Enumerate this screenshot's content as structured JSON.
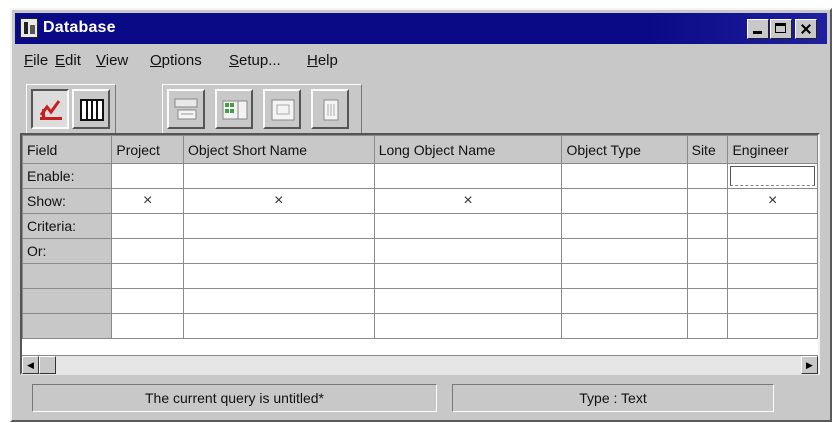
{
  "window": {
    "title": "Database",
    "controls": [
      "minimize-icon",
      "maximize-icon",
      "close-icon"
    ]
  },
  "menu": [
    {
      "label": "File",
      "accel": "F",
      "rest": "ile"
    },
    {
      "label": "Edit",
      "accel": "E",
      "rest": "dit"
    },
    {
      "label": "View",
      "accel": "V",
      "rest": "iew"
    },
    {
      "label": "Options",
      "accel": "O",
      "rest": "ptions"
    },
    {
      "label": "Setup...",
      "accel": "S",
      "rest": "etup..."
    },
    {
      "label": "Help",
      "accel": "H",
      "rest": "elp"
    }
  ],
  "toolbar": {
    "group1": [
      "query-chart-icon",
      "grid-view-icon"
    ],
    "group2": [
      "form-view-icon",
      "table-columns-icon",
      "report-icon",
      "trash-icon"
    ]
  },
  "grid": {
    "columns": [
      "Field",
      "Project",
      "Object Short Name",
      "Long Object Name",
      "Object Type",
      "Site",
      "Engineer"
    ],
    "rows": [
      {
        "label": "Enable:",
        "cells": [
          "",
          "",
          "",
          "",
          "",
          ""
        ]
      },
      {
        "label": "Show:",
        "cells": [
          "×",
          "×",
          "×",
          "",
          "",
          "×"
        ]
      },
      {
        "label": "Criteria:",
        "cells": [
          "",
          "",
          "",
          "",
          "",
          ""
        ]
      },
      {
        "label": "Or:",
        "cells": [
          "",
          "",
          "",
          "",
          "",
          ""
        ]
      },
      {
        "label": "",
        "cells": [
          "",
          "",
          "",
          "",
          "",
          ""
        ]
      },
      {
        "label": "",
        "cells": [
          "",
          "",
          "",
          "",
          "",
          ""
        ]
      },
      {
        "label": "",
        "cells": [
          "",
          "",
          "",
          "",
          "",
          ""
        ]
      }
    ]
  },
  "status": {
    "query": "The current query is untitled*",
    "type": "Type : Text"
  },
  "colors": {
    "titlebar": "#0a0a86",
    "face": "#c8c8c8",
    "accent_red": "#c81e1e"
  }
}
